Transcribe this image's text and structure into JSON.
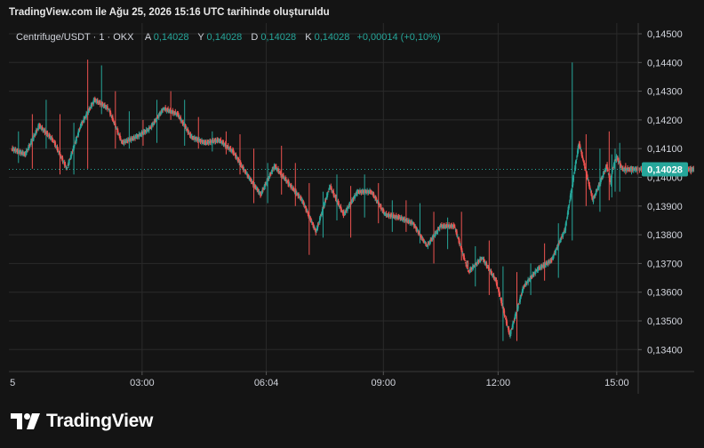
{
  "caption": "TradingView.com ile Ağu 25, 2026 15:16 UTC tarihinde oluşturuldu",
  "legend": {
    "symbol": "Centrifuge/USDT · 1 · OKX",
    "open_label": "A",
    "open": "0,14028",
    "high_label": "Y",
    "high": "0,14028",
    "low_label": "D",
    "low": "0,14028",
    "close_label": "K",
    "close": "0,14028",
    "change": "+0,00014 (+0,10%)"
  },
  "brand": "TradingView",
  "colors": {
    "background": "#141414",
    "grid": "#2a2a2a",
    "up": "#26a69a",
    "down": "#ef5350",
    "price_label": "#26a69a",
    "text": "#d1d4dc",
    "legend_value": "#26a69a"
  },
  "chart_data": {
    "type": "candlestick",
    "title": "Centrifuge/USDT · 1 · OKX",
    "x_ticks": [
      "5",
      "03:00",
      "06:04",
      "09:00",
      "12:00",
      "15:00"
    ],
    "y_ticks": [
      "0,14500",
      "0,14400",
      "0,14300",
      "0,14200",
      "0,14100",
      "0,14000",
      "0,13900",
      "0,13800",
      "0,13700",
      "0,13600",
      "0,13500",
      "0,13400"
    ],
    "ylim": [
      0.13365,
      0.1453
    ],
    "current_price": 0.14028,
    "current_price_label": "0,14028",
    "grid": true,
    "series": [
      {
        "x": [
          0,
          0.35,
          0.7,
          1.05,
          1.4,
          1.75,
          2.1,
          2.45,
          2.8,
          3.15,
          3.5,
          3.85,
          4.2,
          4.55,
          4.9,
          5.25,
          5.6,
          5.95,
          6.3,
          6.65,
          7,
          7.35,
          7.7,
          8.05,
          8.4,
          8.75,
          9.1,
          9.45,
          9.8,
          10.15,
          10.5,
          10.85,
          11.2,
          11.55,
          11.9,
          12.25,
          12.6,
          12.95,
          13.3,
          13.65,
          14,
          14.35,
          14.7,
          15.05,
          15.15,
          15.2,
          15.3,
          15.45,
          15.6,
          15.75,
          15.9,
          16.05,
          16.2,
          16.35,
          16.5,
          16.65,
          16.8,
          16.95,
          17.1,
          17.25,
          17.4
        ],
        "open": [
          0.141,
          0.1408,
          0.1418,
          0.1413,
          0.1403,
          0.1418,
          0.1427,
          0.1424,
          0.1412,
          0.1414,
          0.1417,
          0.1424,
          0.1422,
          0.1414,
          0.1412,
          0.1413,
          0.1409,
          0.1401,
          0.1394,
          0.1404,
          0.1398,
          0.1392,
          0.1381,
          0.1397,
          0.1387,
          0.1395,
          0.1395,
          0.1387,
          0.1386,
          0.1384,
          0.1376,
          0.1383,
          0.1383,
          0.1367,
          0.1372,
          0.1364,
          0.1345,
          0.1362,
          0.1368,
          0.1371,
          0.1382,
          0.1412,
          0.1392,
          0.1404,
          0.1398,
          0.1403,
          0.1407,
          0.14028,
          0.14028,
          0.14028,
          0.14028,
          0.14028,
          0.14028,
          0.14028,
          0.14028,
          0.14028,
          0.14028,
          0.14028,
          0.14028,
          0.14028,
          0.14028
        ],
        "high": [
          0.1416,
          0.1422,
          0.1427,
          0.1422,
          0.1419,
          0.1441,
          0.1439,
          0.143,
          0.1423,
          0.142,
          0.1427,
          0.143,
          0.1427,
          0.1421,
          0.1416,
          0.1416,
          0.1415,
          0.141,
          0.1405,
          0.1411,
          0.1405,
          0.1398,
          0.1395,
          0.1401,
          0.1397,
          0.1401,
          0.1398,
          0.1392,
          0.1392,
          0.1391,
          0.1388,
          0.1386,
          0.1388,
          0.1376,
          0.1378,
          0.1369,
          0.1367,
          0.137,
          0.1377,
          0.1384,
          0.144,
          0.1415,
          0.141,
          0.1416,
          0.1408,
          0.141,
          0.1412,
          0.1405,
          0.1404,
          0.1404,
          0.1404,
          0.1404,
          0.1404,
          0.1404,
          0.1404,
          0.1404,
          0.1404,
          0.1404,
          0.1404,
          0.1404,
          0.1404
        ],
        "low": [
          0.1405,
          0.1403,
          0.141,
          0.1401,
          0.1401,
          0.1403,
          0.1422,
          0.141,
          0.141,
          0.1411,
          0.1412,
          0.142,
          0.1411,
          0.141,
          0.1409,
          0.1408,
          0.1401,
          0.1391,
          0.1391,
          0.1394,
          0.139,
          0.1373,
          0.1379,
          0.1385,
          0.1379,
          0.1386,
          0.1384,
          0.1381,
          0.1381,
          0.1377,
          0.137,
          0.1375,
          0.1371,
          0.1362,
          0.1359,
          0.1343,
          0.1343,
          0.1359,
          0.1364,
          0.1365,
          0.1378,
          0.139,
          0.1388,
          0.1392,
          0.1393,
          0.1395,
          0.1395,
          0.1401,
          0.1401,
          0.1401,
          0.1401,
          0.1401,
          0.1401,
          0.1401,
          0.1401,
          0.1401,
          0.1401,
          0.1401,
          0.1401,
          0.1401,
          0.1401
        ],
        "close": [
          0.1408,
          0.1418,
          0.1413,
          0.1403,
          0.1418,
          0.1427,
          0.1424,
          0.1412,
          0.1414,
          0.1417,
          0.1424,
          0.1422,
          0.1414,
          0.1412,
          0.1413,
          0.1409,
          0.1401,
          0.1394,
          0.1404,
          0.1398,
          0.1392,
          0.1381,
          0.1397,
          0.1387,
          0.1395,
          0.1395,
          0.1387,
          0.1386,
          0.1384,
          0.1376,
          0.1383,
          0.1383,
          0.1367,
          0.1372,
          0.1364,
          0.1345,
          0.1362,
          0.1368,
          0.1371,
          0.1382,
          0.1412,
          0.1392,
          0.1404,
          0.1398,
          0.1403,
          0.1407,
          0.14028,
          0.14028,
          0.14028,
          0.14028,
          0.14028,
          0.14028,
          0.14028,
          0.14028,
          0.14028,
          0.14028,
          0.14028,
          0.14028,
          0.14028,
          0.14028,
          0.14028
        ]
      }
    ]
  }
}
